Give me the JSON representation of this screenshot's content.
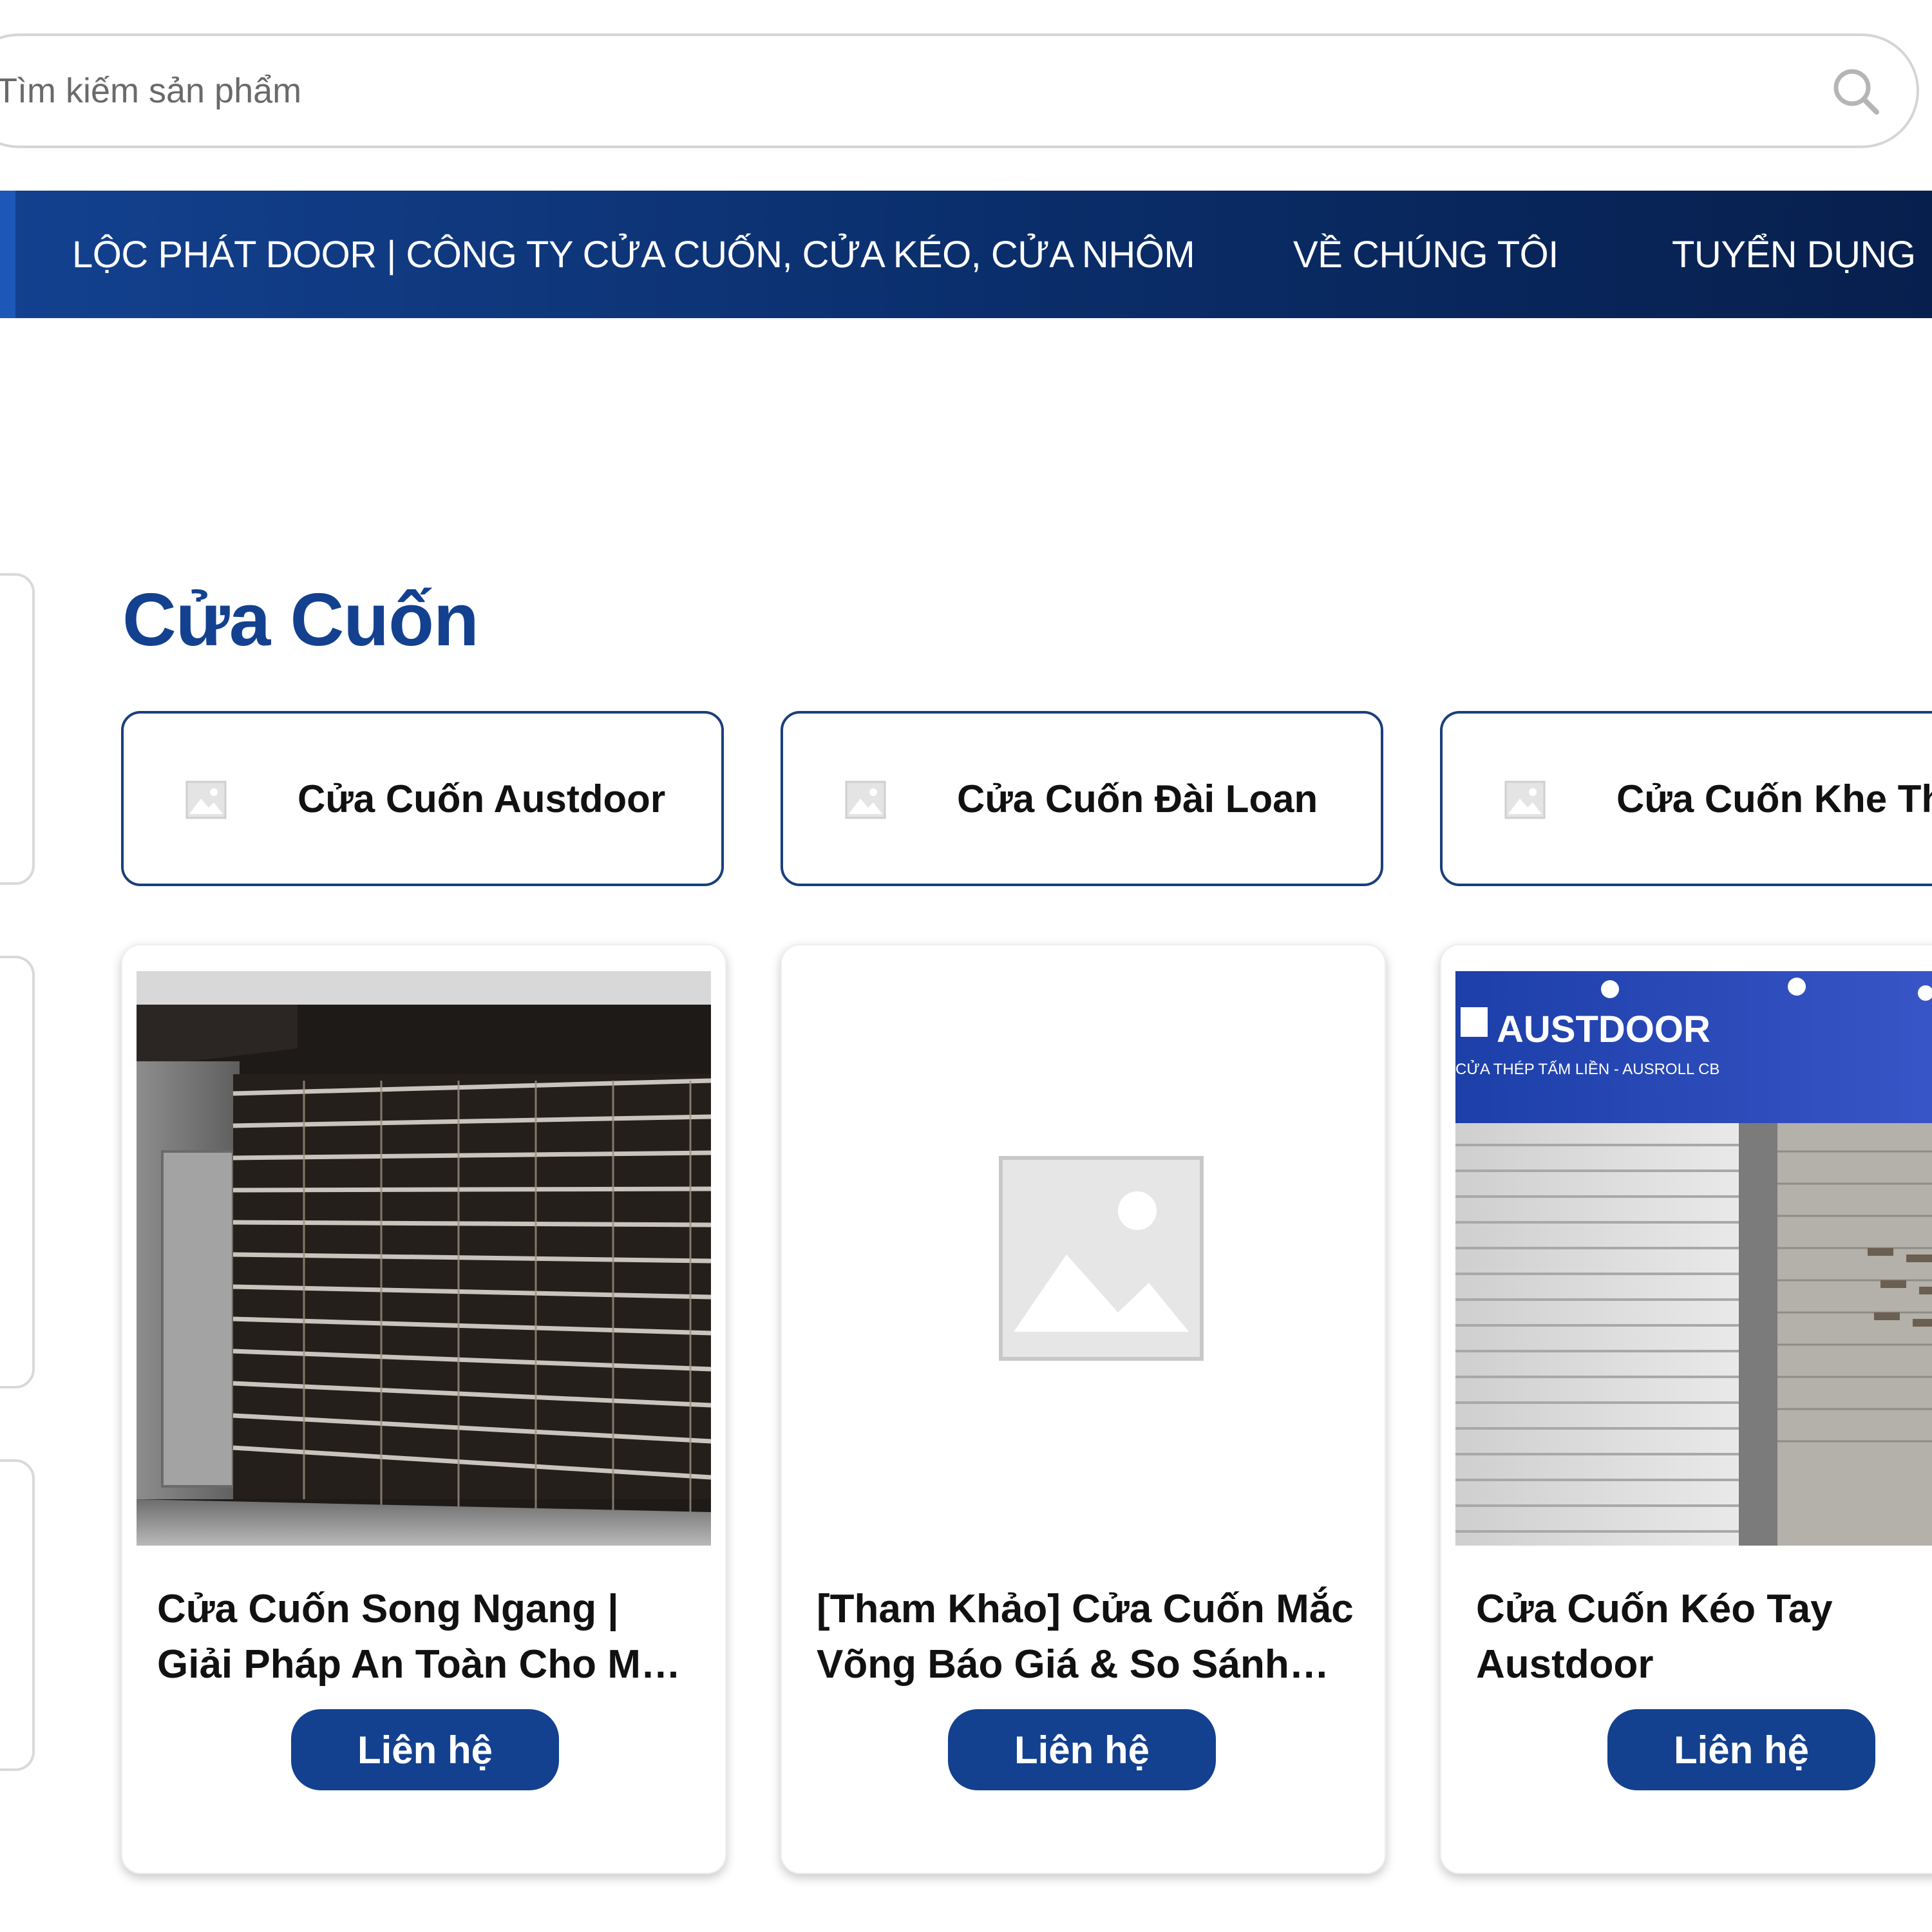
{
  "search": {
    "placeholder": "Tìm kiếm sản phẩm",
    "icon": "search-icon"
  },
  "nav": {
    "items": [
      {
        "label": "LỘC PHÁT DOOR | CÔNG TY CỬA CUỐN, CỬA KÉO, CỬA NHÔM"
      },
      {
        "label": "VỀ CHÚNG TÔI"
      },
      {
        "label": "TUYỂN DỤNG"
      }
    ]
  },
  "page": {
    "title": "Cửa Cuốn"
  },
  "categories": [
    {
      "label": "Cửa Cuốn Austdoor",
      "icon": "image-placeholder-icon"
    },
    {
      "label": "Cửa Cuốn Đài Loan",
      "icon": "image-placeholder-icon"
    },
    {
      "label": "Cửa Cuốn Khe Thoáng",
      "icon": "image-placeholder-icon"
    }
  ],
  "products": [
    {
      "title": "Cửa Cuốn Song Ngang | Giải Pháp An Toàn Cho Mọi Công Trình",
      "button": "Liên hệ",
      "image": "rolling-grille-photo"
    },
    {
      "title": "[Tham Khảo] Cửa Cuốn Mắc Võng Báo Giá & So Sánh Chi Tiết",
      "button": "Liên hệ",
      "image": "image-placeholder-icon"
    },
    {
      "title": "Cửa Cuốn Kéo Tay Austdoor",
      "button": "Liên hệ",
      "image": "austdoor-showroom-photo"
    }
  ],
  "photo_text": {
    "brand": "AUSTDOOR",
    "sub": "CỬA THÉP TẤM LIỀN - AUSROLL CB"
  },
  "colors": {
    "brand_blue": "#13418f",
    "nav_dark": "#071f4d",
    "chip_border": "#1a3f7a"
  }
}
